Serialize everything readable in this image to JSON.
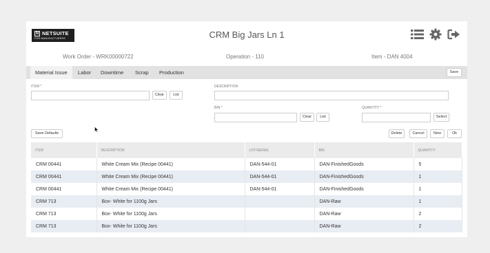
{
  "header": {
    "logo_brand": "NETSUITE",
    "logo_tag": "FOR MANUFACTURERS",
    "title": "CRM Big Jars Ln 1",
    "icons": [
      "list-icon",
      "gear-icon",
      "sign-out-icon"
    ]
  },
  "info": {
    "work_order": "Work Order - WRK00000722",
    "operation": "Operation - 110",
    "item": "Item - DAN 4004"
  },
  "tabs": [
    "Material Issue",
    "Labor",
    "Downtime",
    "Scrap",
    "Production"
  ],
  "save_label": "Save",
  "form": {
    "item_label": "ITEM *",
    "description_label": "DESCRIPTION",
    "bin_label": "BIN *",
    "quantity_label": "QUANTITY *",
    "clear_label": "Clear",
    "list_label": "List",
    "select_label": "Select",
    "item_value": "",
    "description_value": "",
    "bin_value": "",
    "quantity_value": ""
  },
  "actions": {
    "save_defaults": "Save Defaults",
    "delete": "Delete",
    "cancel": "Cancel",
    "new": "New",
    "ok": "Ok"
  },
  "table": {
    "headers": [
      "ITEM",
      "DESCRIPTION",
      "LOT/SERIAL",
      "BIN",
      "QUANTITY"
    ],
    "rows": [
      [
        "CRM 00441",
        "White Cream Mix (Recipe 00441)",
        "DAN-544-01",
        "DAN-FinishedGoods",
        "5"
      ],
      [
        "CRM 00441",
        "White Cream Mix (Recipe 00441)",
        "DAN-544-01",
        "DAN-FinishedGoods",
        "1"
      ],
      [
        "CRM 00441",
        "White Cream Mix (Recipe 00441)",
        "DAN-544-01",
        "DAN-FinishedGoods",
        "1"
      ],
      [
        "CRM 713",
        "Box- White for 1100g Jars",
        "",
        "DAN-Raw",
        "1"
      ],
      [
        "CRM 713",
        "Box- White for 1100g Jars",
        "",
        "DAN-Raw",
        "2"
      ],
      [
        "CRM 713",
        "Box- White for 1100g Jars",
        "",
        "DAN-Raw",
        "2"
      ]
    ]
  }
}
